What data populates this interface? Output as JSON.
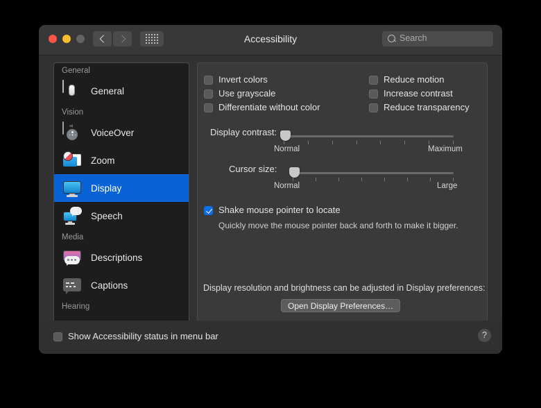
{
  "window": {
    "title": "Accessibility",
    "traffic_lights": {
      "close": "close",
      "minimize": "minimize",
      "zoom": "zoom"
    },
    "nav": {
      "back": "‹",
      "forward": "›",
      "grid": "show-all"
    },
    "search": {
      "placeholder": "Search"
    }
  },
  "sidebar": {
    "groups": [
      {
        "header": "General",
        "items": [
          {
            "label": "General",
            "icon": "general-icon",
            "selected": false
          }
        ]
      },
      {
        "header": "Vision",
        "items": [
          {
            "label": "VoiceOver",
            "icon": "voiceover-icon",
            "selected": false
          },
          {
            "label": "Zoom",
            "icon": "zoom-icon",
            "selected": false
          },
          {
            "label": "Display",
            "icon": "display-icon",
            "selected": true
          },
          {
            "label": "Speech",
            "icon": "speech-icon",
            "selected": false
          }
        ]
      },
      {
        "header": "Media",
        "items": [
          {
            "label": "Descriptions",
            "icon": "descriptions-icon",
            "selected": false
          },
          {
            "label": "Captions",
            "icon": "captions-icon",
            "selected": false
          }
        ]
      },
      {
        "header": "Hearing",
        "items": []
      }
    ]
  },
  "pane": {
    "checkboxes": [
      {
        "label": "Invert colors",
        "checked": false
      },
      {
        "label": "Use grayscale",
        "checked": false
      },
      {
        "label": "Differentiate without color",
        "checked": false
      },
      {
        "label": "Reduce motion",
        "checked": false
      },
      {
        "label": "Increase contrast",
        "checked": false
      },
      {
        "label": "Reduce transparency",
        "checked": false
      }
    ],
    "sliders": [
      {
        "label": "Display contrast:",
        "min_label": "Normal",
        "max_label": "Maximum",
        "value": 0,
        "ticks": 8
      },
      {
        "label": "Cursor size:",
        "min_label": "Normal",
        "max_label": "Large",
        "value": 0,
        "ticks": 8
      }
    ],
    "shake": {
      "label": "Shake mouse pointer to locate",
      "checked": true,
      "description": "Quickly move the mouse pointer back and forth to make it bigger."
    },
    "display_note": "Display resolution and brightness can be adjusted in Display preferences:",
    "open_display_button": "Open Display Preferences…"
  },
  "footer": {
    "status_label": "Show Accessibility status in menu bar",
    "status_checked": false,
    "help": "?"
  },
  "colors": {
    "accent": "#0a63d6",
    "checkbox_accent": "#0a6fe8",
    "window_bg": "#323232",
    "pane_bg": "#3a3a3a",
    "sidebar_bg": "#1d1d1d",
    "footer_bg": "#303030",
    "close": "#f9544b",
    "minimize": "#f7bd2e",
    "zoom_light": "#636363"
  }
}
